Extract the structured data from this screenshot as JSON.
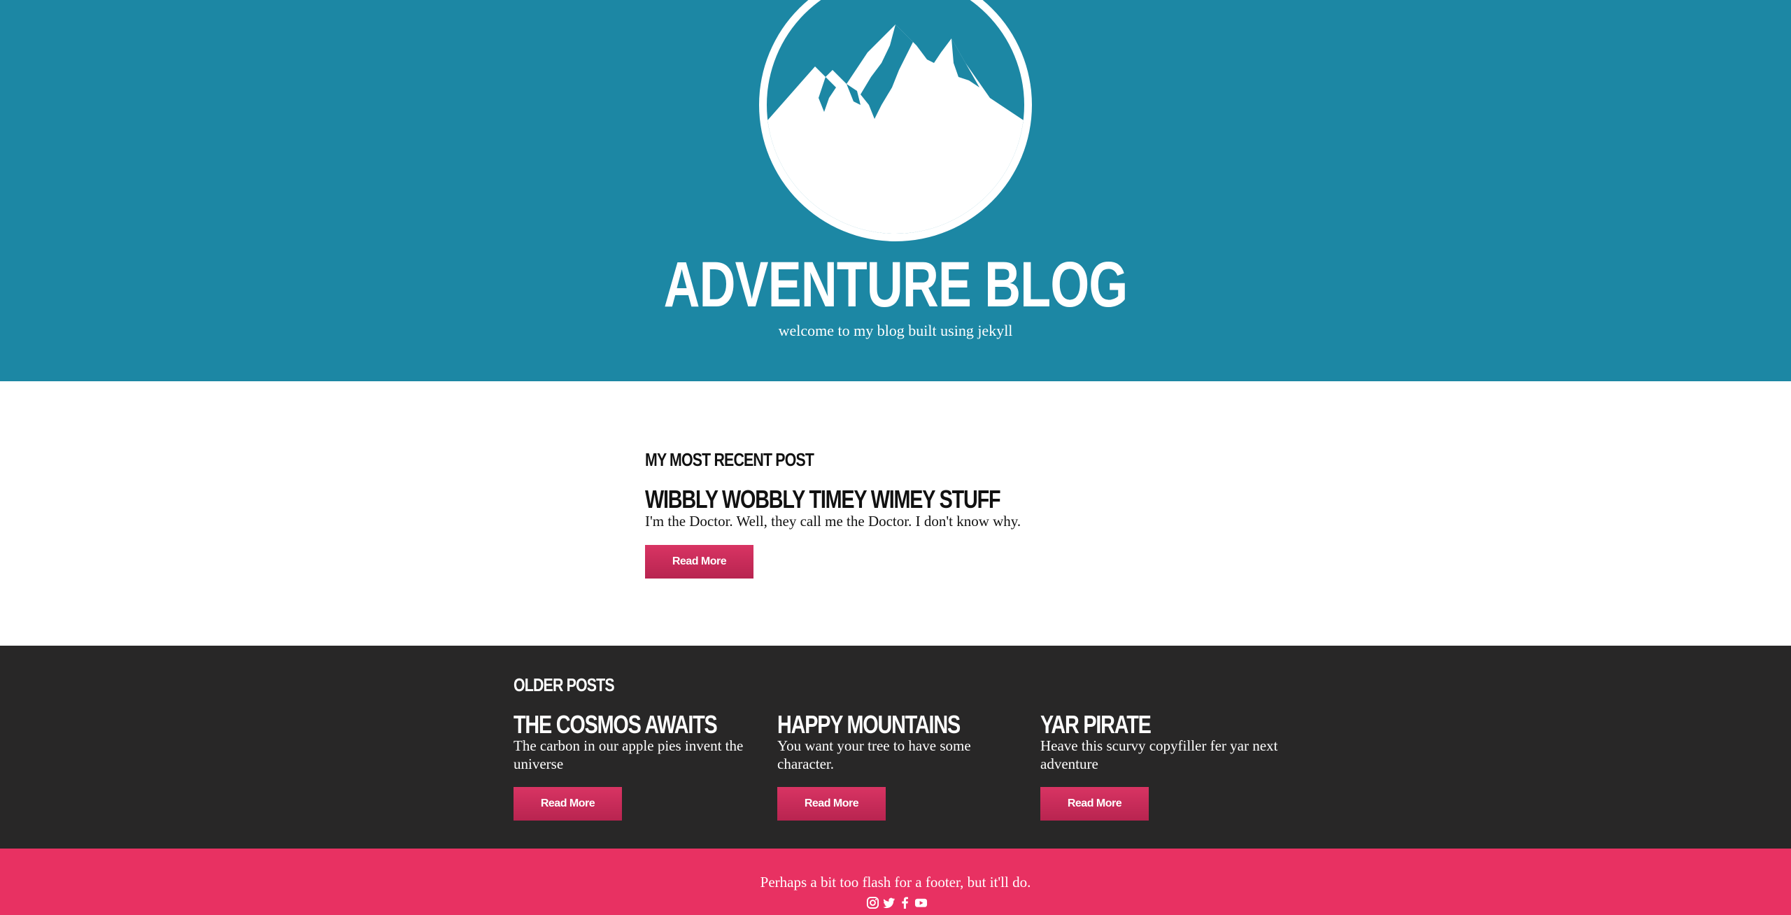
{
  "header": {
    "logo_icon": "mountain-logo-icon",
    "title": "ADVENTURE BLOG",
    "tagline": "welcome to my blog built using jekyll"
  },
  "recent": {
    "label": "MY MOST RECENT POST",
    "post": {
      "title": "WIBBLY WOBBLY TIMEY WIMEY STUFF",
      "excerpt": "I'm the Doctor. Well, they call me the Doctor. I don't know why.",
      "button": "Read More"
    }
  },
  "older": {
    "label": "OLDER POSTS",
    "posts": [
      {
        "title": "THE COSMOS AWAITS",
        "excerpt": "The carbon in our apple pies invent the universe",
        "button": "Read More"
      },
      {
        "title": "HAPPY MOUNTAINS",
        "excerpt": "You want your tree to have some character.",
        "button": "Read More"
      },
      {
        "title": "YAR PIRATE",
        "excerpt": "Heave this scurvy copyfiller fer yar next adventure",
        "button": "Read More"
      }
    ]
  },
  "footer": {
    "text": "Perhaps a bit too flash for a footer, but it'll do.",
    "social_icons": [
      "instagram-icon",
      "twitter-icon",
      "facebook-icon",
      "youtube-icon"
    ]
  },
  "colors": {
    "header_bg": "#1c87a4",
    "older_bg": "#282727",
    "footer_bg": "#e83162",
    "button": "#c92a59"
  }
}
